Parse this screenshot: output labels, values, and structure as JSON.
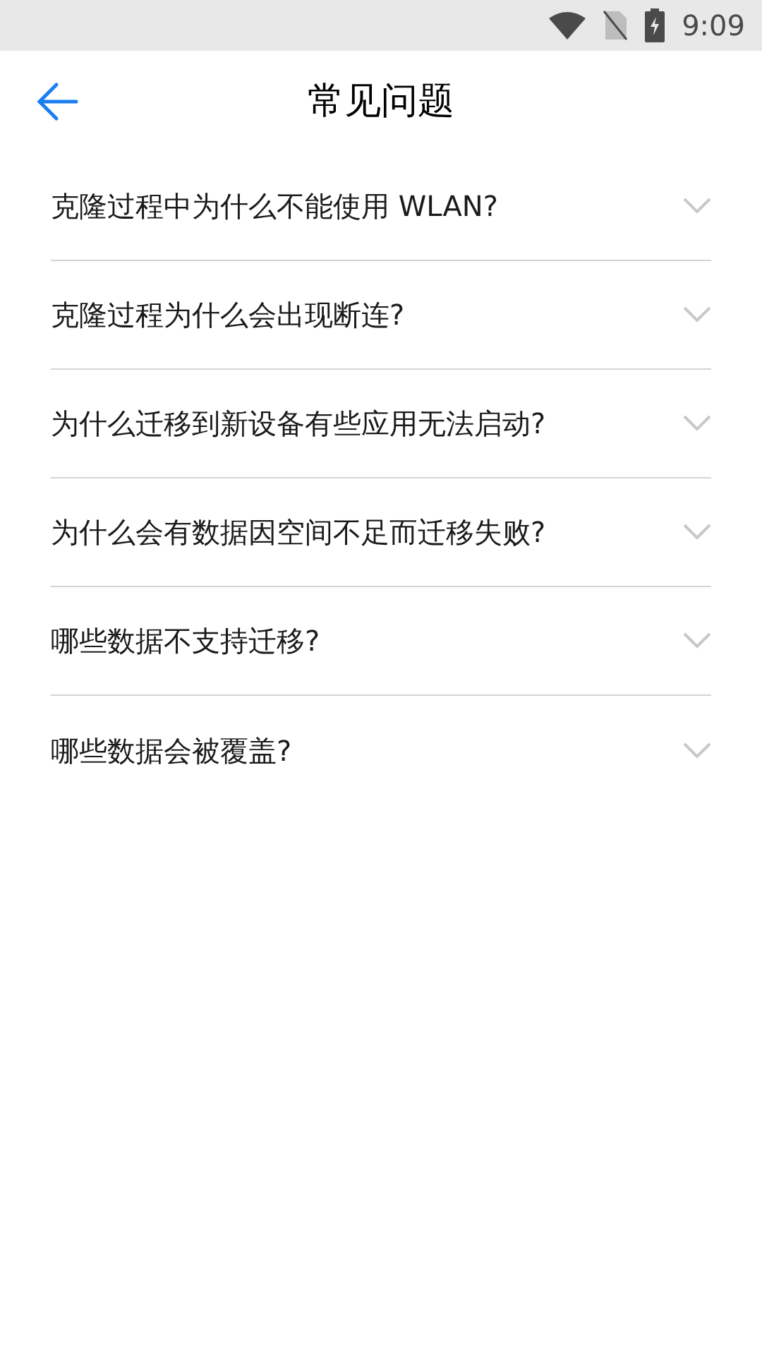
{
  "status_bar": {
    "time": "9:09"
  },
  "header": {
    "title": "常见问题"
  },
  "faq": [
    {
      "question": "克隆过程中为什么不能使用 WLAN?",
      "expanded": false
    },
    {
      "question": "克隆过程为什么会出现断连?",
      "expanded": false
    },
    {
      "question": "为什么迁移到新设备有些应用无法启动?",
      "expanded": false
    },
    {
      "question": "为什么会有数据因空间不足而迁移失败?",
      "expanded": false
    },
    {
      "question": "哪些数据不支持迁移?",
      "expanded": false
    },
    {
      "question": "哪些数据会被覆盖?",
      "expanded": false
    }
  ]
}
